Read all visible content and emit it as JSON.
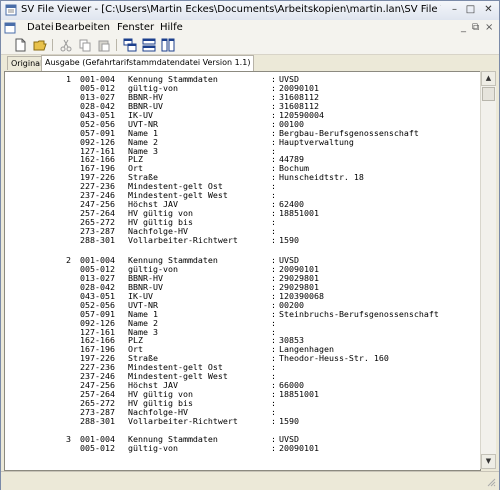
{
  "window": {
    "title": "SV File Viewer - [C:\\Users\\Martin Eckes\\Documents\\Arbeitskopien\\martin.lan\\SV File View\\Bin\\Beispiele\\UVSD...",
    "minimize": "–",
    "maximize": "□",
    "close": "✕"
  },
  "menu": {
    "items": [
      "Datei",
      "Bearbeiten",
      "Fenster",
      "Hilfe"
    ],
    "mdi_minimize": "_",
    "mdi_restore": "⧉",
    "mdi_close": "×"
  },
  "toolbar": {
    "icons": [
      "new-file-icon",
      "open-folder-icon",
      "cut-icon",
      "copy-icon",
      "paste-icon",
      "cascade-icon",
      "tile-horizontal-icon",
      "tile-vertical-icon"
    ]
  },
  "tabs": [
    {
      "label": "Original",
      "active": false
    },
    {
      "label": "Ausgabe (Gefahrtarifstammdatendatei Version 1.1)",
      "active": true
    }
  ],
  "records": [
    {
      "number": "1",
      "fields": [
        {
          "code": "001-004",
          "label": "Kennung Stammdaten",
          "value": "UVSD"
        },
        {
          "code": "005-012",
          "label": "gültig-von",
          "value": "20090101"
        },
        {
          "code": "013-027",
          "label": "BBNR-HV",
          "value": "31608112"
        },
        {
          "code": "028-042",
          "label": "BBNR-UV",
          "value": "31608112"
        },
        {
          "code": "043-051",
          "label": "IK-UV",
          "value": "120590004"
        },
        {
          "code": "052-056",
          "label": "UVT-NR",
          "value": "00100"
        },
        {
          "code": "057-091",
          "label": "Name 1",
          "value": "Bergbau-Berufsgenossenschaft"
        },
        {
          "code": "092-126",
          "label": "Name 2",
          "value": "Hauptverwaltung"
        },
        {
          "code": "127-161",
          "label": "Name 3",
          "value": ""
        },
        {
          "code": "162-166",
          "label": "PLZ",
          "value": "44789"
        },
        {
          "code": "167-196",
          "label": "Ort",
          "value": "Bochum"
        },
        {
          "code": "197-226",
          "label": "Straße",
          "value": "Hunscheidtstr. 18"
        },
        {
          "code": "227-236",
          "label": "Mindestent-gelt Ost",
          "value": ""
        },
        {
          "code": "237-246",
          "label": "Mindestent-gelt West",
          "value": ""
        },
        {
          "code": "247-256",
          "label": "Höchst JAV",
          "value": "62400"
        },
        {
          "code": "257-264",
          "label": "HV gültig von",
          "value": "18851001"
        },
        {
          "code": "265-272",
          "label": "HV gültig bis",
          "value": ""
        },
        {
          "code": "273-287",
          "label": "Nachfolge-HV",
          "value": ""
        },
        {
          "code": "288-301",
          "label": "Vollarbeiter-Richtwert",
          "value": "1590"
        }
      ]
    },
    {
      "number": "2",
      "fields": [
        {
          "code": "001-004",
          "label": "Kennung Stammdaten",
          "value": "UVSD"
        },
        {
          "code": "005-012",
          "label": "gültig-von",
          "value": "20090101"
        },
        {
          "code": "013-027",
          "label": "BBNR-HV",
          "value": "29029801"
        },
        {
          "code": "028-042",
          "label": "BBNR-UV",
          "value": "29029801"
        },
        {
          "code": "043-051",
          "label": "IK-UV",
          "value": "120390068"
        },
        {
          "code": "052-056",
          "label": "UVT-NR",
          "value": "00200"
        },
        {
          "code": "057-091",
          "label": "Name 1",
          "value": "Steinbruchs-Berufsgenossenschaft"
        },
        {
          "code": "092-126",
          "label": "Name 2",
          "value": ""
        },
        {
          "code": "127-161",
          "label": "Name 3",
          "value": ""
        },
        {
          "code": "162-166",
          "label": "PLZ",
          "value": "30853"
        },
        {
          "code": "167-196",
          "label": "Ort",
          "value": "Langenhagen"
        },
        {
          "code": "197-226",
          "label": "Straße",
          "value": "Theodor-Heuss-Str. 160"
        },
        {
          "code": "227-236",
          "label": "Mindestent-gelt Ost",
          "value": ""
        },
        {
          "code": "237-246",
          "label": "Mindestent-gelt West",
          "value": ""
        },
        {
          "code": "247-256",
          "label": "Höchst JAV",
          "value": "66000"
        },
        {
          "code": "257-264",
          "label": "HV gültig von",
          "value": "18851001"
        },
        {
          "code": "265-272",
          "label": "HV gültig bis",
          "value": ""
        },
        {
          "code": "273-287",
          "label": "Nachfolge-HV",
          "value": ""
        },
        {
          "code": "288-301",
          "label": "Vollarbeiter-Richtwert",
          "value": "1590"
        }
      ]
    },
    {
      "number": "3",
      "fields": [
        {
          "code": "001-004",
          "label": "Kennung Stammdaten",
          "value": "UVSD"
        },
        {
          "code": "005-012",
          "label": "gültig-von",
          "value": "20090101"
        }
      ]
    }
  ],
  "colon": ":"
}
